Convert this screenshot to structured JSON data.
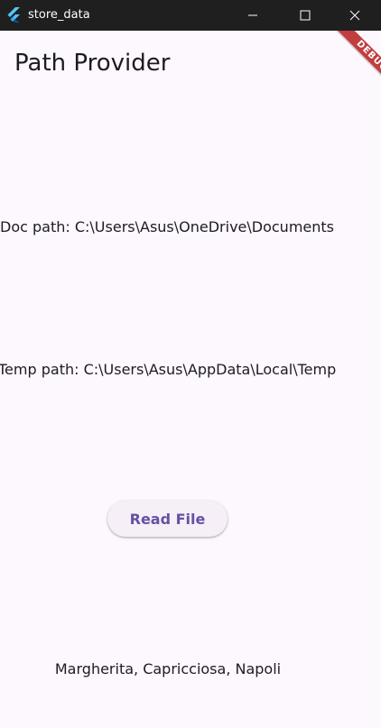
{
  "window": {
    "title": "store_data",
    "minimize_icon": "minimize-icon",
    "maximize_icon": "maximize-icon",
    "close_icon": "close-icon"
  },
  "appbar": {
    "title": "Path Provider"
  },
  "debug_banner": {
    "label": "DEBUG",
    "color": "#b71c1c"
  },
  "main": {
    "doc_path": "Doc path: C:\\Users\\Asus\\OneDrive\\Documents",
    "temp_path": "Temp path: C:\\Users\\Asus\\AppData\\Local\\Temp",
    "read_button_label": "Read File",
    "file_content": "Margherita, Capricciosa, Napoli"
  },
  "colors": {
    "background": "#fdf7fe",
    "titlebar": "#1f1f1f",
    "accent": "#6750a4",
    "text": "#1d1b20"
  }
}
